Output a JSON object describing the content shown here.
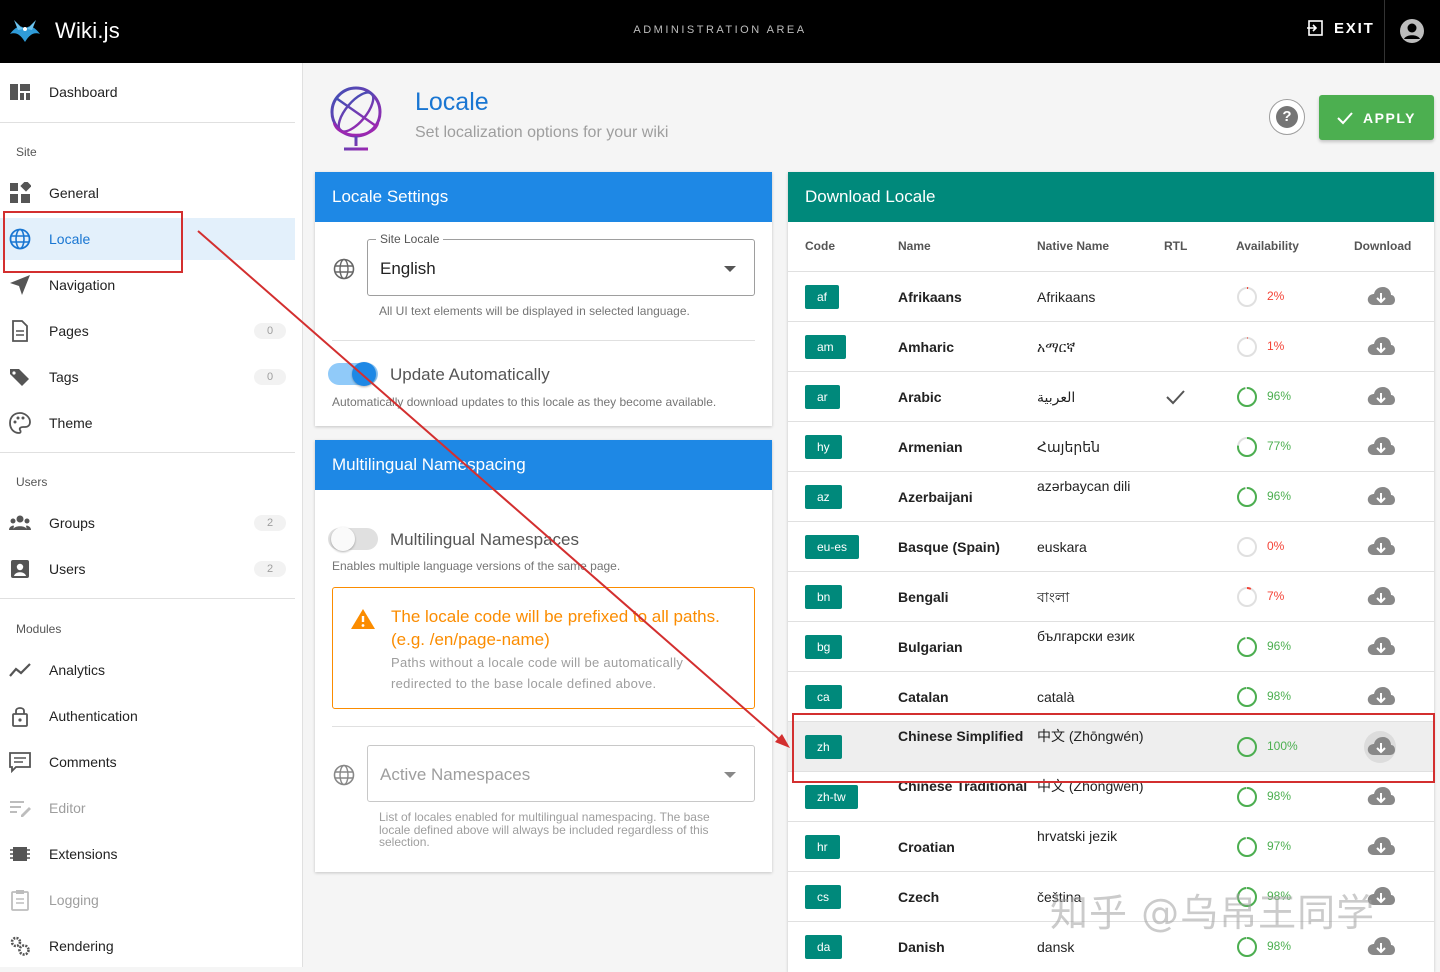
{
  "app": {
    "name": "Wiki.js",
    "area_title": "ADMINISTRATION AREA",
    "exit_label": "EXIT"
  },
  "sidebar": {
    "dashboard": {
      "label": "Dashboard",
      "icon": "dashboard-icon"
    },
    "sections": {
      "site": "Site",
      "users": "Users",
      "modules": "Modules"
    },
    "site_items": [
      {
        "label": "General",
        "icon": "widgets-icon"
      },
      {
        "label": "Locale",
        "icon": "globe-icon",
        "active": true
      },
      {
        "label": "Navigation",
        "icon": "navigation-arrow-icon"
      },
      {
        "label": "Pages",
        "icon": "page-icon",
        "badge": "0"
      },
      {
        "label": "Tags",
        "icon": "tags-icon",
        "badge": "0"
      },
      {
        "label": "Theme",
        "icon": "palette-icon"
      }
    ],
    "user_items": [
      {
        "label": "Groups",
        "icon": "groups-icon",
        "badge": "2"
      },
      {
        "label": "Users",
        "icon": "user-card-icon",
        "badge": "2"
      }
    ],
    "module_items": [
      {
        "label": "Analytics",
        "icon": "analytics-icon"
      },
      {
        "label": "Authentication",
        "icon": "lock-icon"
      },
      {
        "label": "Comments",
        "icon": "comment-icon"
      },
      {
        "label": "Editor",
        "icon": "editor-icon",
        "dimmed": true
      },
      {
        "label": "Extensions",
        "icon": "chip-icon"
      },
      {
        "label": "Logging",
        "icon": "clipboard-icon",
        "dimmed": true
      },
      {
        "label": "Rendering",
        "icon": "cogs-icon"
      }
    ]
  },
  "header": {
    "title": "Locale",
    "subtitle": "Set localization options for your wiki",
    "apply_label": "APPLY",
    "help_label": "?"
  },
  "locale_settings": {
    "title": "Locale Settings",
    "site_locale_label": "Site Locale",
    "site_locale_value": "English",
    "site_locale_hint": "All UI text elements will be displayed in selected language.",
    "auto_update_label": "Update Automatically",
    "auto_update_on": true,
    "auto_update_hint": "Automatically download updates to this locale as they become available."
  },
  "namespacing": {
    "title": "Multilingual Namespacing",
    "toggle_label": "Multilingual Namespaces",
    "toggle_on": false,
    "toggle_hint": "Enables multiple language versions of the same page.",
    "alert_title": "The locale code will be prefixed to all paths. (e.g. /en/page-name)",
    "alert_body": "Paths without a locale code will be automatically redirected to the base locale defined above.",
    "active_ns_placeholder": "Active Namespaces",
    "active_ns_hint": "List of locales enabled for multilingual namespacing. The base locale defined above will always be included regardless of this selection."
  },
  "download_locale": {
    "title": "Download Locale",
    "columns": [
      "Code",
      "Name",
      "Native Name",
      "RTL",
      "Availability",
      "Download"
    ],
    "rows": [
      {
        "code": "af",
        "name": "Afrikaans",
        "native": "Afrikaans",
        "rtl": false,
        "availability": "2%",
        "pct": 2
      },
      {
        "code": "am",
        "name": "Amharic",
        "native": "አማርኛ",
        "rtl": false,
        "availability": "1%",
        "pct": 1
      },
      {
        "code": "ar",
        "name": "Arabic",
        "native": "العربية",
        "rtl": true,
        "availability": "96%",
        "pct": 96
      },
      {
        "code": "hy",
        "name": "Armenian",
        "native": "Հայերեն",
        "rtl": false,
        "availability": "77%",
        "pct": 77
      },
      {
        "code": "az",
        "name": "Azerbaijani",
        "native": "azərbaycan dili",
        "rtl": false,
        "availability": "96%",
        "pct": 96
      },
      {
        "code": "eu-es",
        "name": "Basque (Spain)",
        "native": "euskara",
        "rtl": false,
        "availability": "0%",
        "pct": 0
      },
      {
        "code": "bn",
        "name": "Bengali",
        "native": "বাংলা",
        "rtl": false,
        "availability": "7%",
        "pct": 7
      },
      {
        "code": "bg",
        "name": "Bulgarian",
        "native": "български език",
        "rtl": false,
        "availability": "96%",
        "pct": 96
      },
      {
        "code": "ca",
        "name": "Catalan",
        "native": "català",
        "rtl": false,
        "availability": "98%",
        "pct": 98
      },
      {
        "code": "zh",
        "name": "Chinese Simplified",
        "native": "中文 (Zhōngwén)",
        "rtl": false,
        "availability": "100%",
        "pct": 100,
        "highlight": true
      },
      {
        "code": "zh-tw",
        "name": "Chinese Traditional",
        "native": "中文 (Zhōngwén)",
        "rtl": false,
        "availability": "98%",
        "pct": 98
      },
      {
        "code": "hr",
        "name": "Croatian",
        "native": "hrvatski jezik",
        "rtl": false,
        "availability": "97%",
        "pct": 97
      },
      {
        "code": "cs",
        "name": "Czech",
        "native": "čeština",
        "rtl": false,
        "availability": "98%",
        "pct": 98
      },
      {
        "code": "da",
        "name": "Danish",
        "native": "dansk",
        "rtl": false,
        "availability": "98%",
        "pct": 98
      }
    ]
  },
  "watermark": "知乎 @乌帛王同学",
  "colors": {
    "primary": "#1e88e5",
    "teal": "#00897b",
    "success": "#4caf50",
    "warning": "#fb8c00",
    "error": "#f44336",
    "annotation": "#d32f2f"
  }
}
